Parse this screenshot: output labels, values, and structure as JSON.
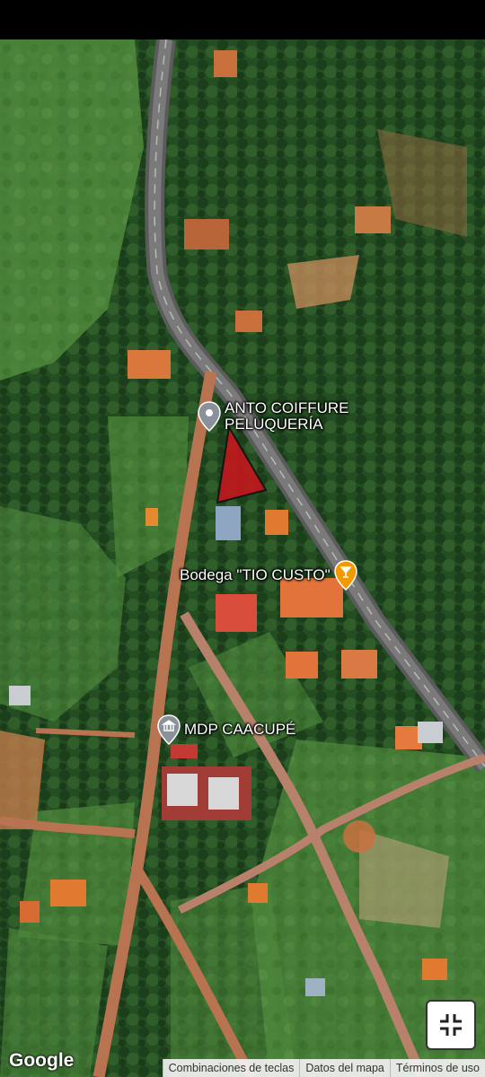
{
  "map": {
    "type": "satellite",
    "labels": {
      "salon": "ANTO COIFFURE\nPELUQUERÍA",
      "bodega": "Bodega \"TIO CUSTO\"",
      "museum": "MDP CAACUPÉ"
    },
    "icons": {
      "salon": "location-pin-icon",
      "bodega": "drink-icon",
      "museum": "landmark-icon",
      "fullscreen": "exit-fullscreen-icon"
    },
    "colors": {
      "pin_gray": "#8a9199",
      "pin_orange": "#f29900",
      "parcel_fill": "#c4161c"
    }
  },
  "branding": {
    "logo": "Google"
  },
  "footer": {
    "links": [
      "Combinaciones de teclas",
      "Datos del mapa",
      "Términos de uso"
    ]
  }
}
